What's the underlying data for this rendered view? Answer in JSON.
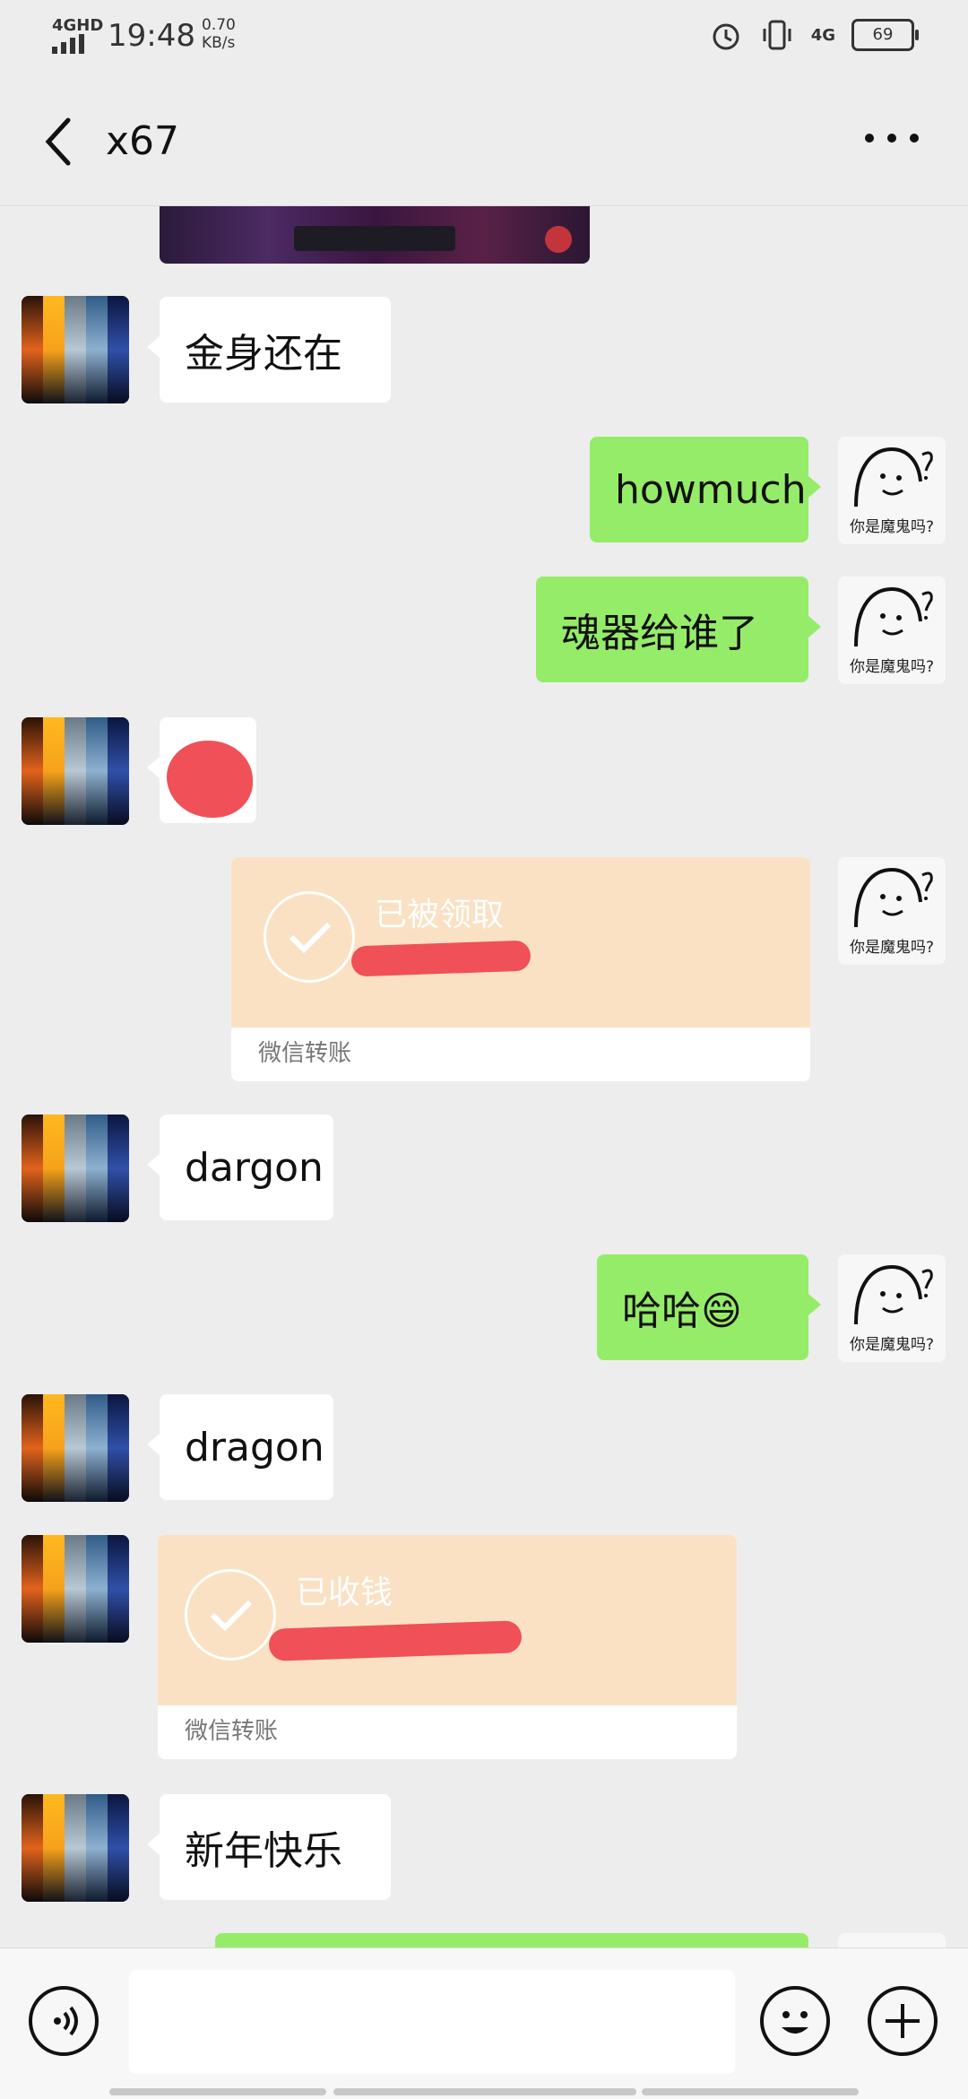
{
  "status_bar": {
    "network": "4GHD",
    "time": "19:48",
    "speed_value": "0.70",
    "speed_unit": "KB/s",
    "right_network": "4G",
    "battery": "69"
  },
  "header": {
    "title": "x67"
  },
  "messages": [
    {
      "type": "image",
      "side": "in"
    },
    {
      "type": "text",
      "side": "in",
      "text": "金身还在"
    },
    {
      "type": "text",
      "side": "out",
      "text": "howmuch"
    },
    {
      "type": "text",
      "side": "out",
      "text": "魂器给谁了"
    },
    {
      "type": "redacted",
      "side": "in"
    },
    {
      "type": "transfer",
      "side": "out",
      "status": "已被领取",
      "footer": "微信转账"
    },
    {
      "type": "text",
      "side": "in",
      "text": "dargon"
    },
    {
      "type": "text",
      "side": "out",
      "text": "哈哈😄"
    },
    {
      "type": "text",
      "side": "in",
      "text": "dragon"
    },
    {
      "type": "transfer",
      "side": "in",
      "status": "已收钱",
      "footer": "微信转账"
    },
    {
      "type": "text",
      "side": "in",
      "text": "新年快乐"
    }
  ],
  "sticker": {
    "text": "你是魔鬼吗?"
  },
  "input": {
    "placeholder": ""
  },
  "icons": [
    "back-icon",
    "more-icon",
    "voice-icon",
    "emoji-icon",
    "plus-icon"
  ]
}
